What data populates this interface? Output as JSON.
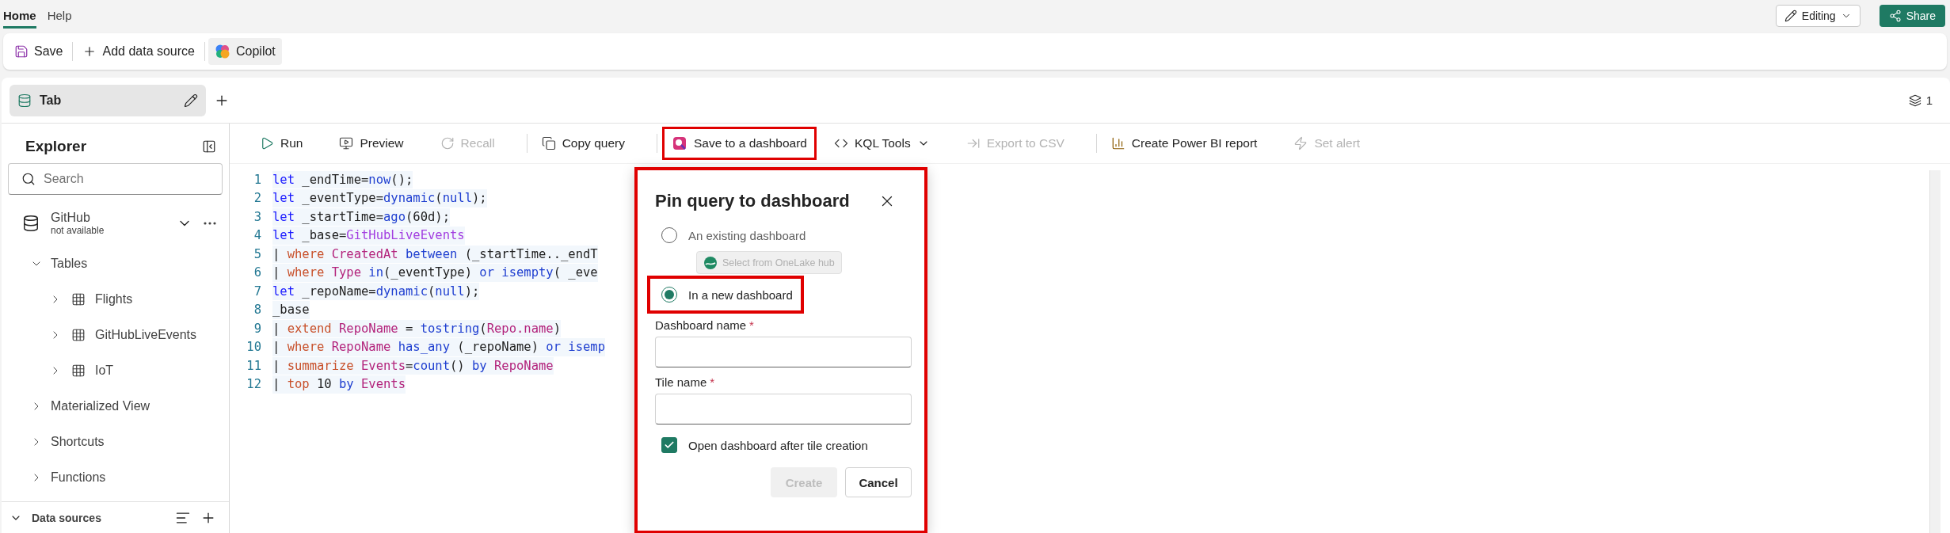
{
  "menu": {
    "tabs": [
      {
        "label": "Home",
        "selected": true
      },
      {
        "label": "Help",
        "selected": false
      }
    ],
    "mode": "Editing",
    "share": "Share"
  },
  "ribbon": [
    {
      "label": "Save",
      "kind": "save"
    },
    {
      "label": "Add data source",
      "kind": "add"
    },
    {
      "label": "Copilot",
      "kind": "copilot"
    }
  ],
  "query_tabs": [
    {
      "label": "Tab",
      "selected": true
    }
  ],
  "tab_count": "1",
  "explorer": {
    "title": "Explorer",
    "search": {
      "placeholder": "Search"
    },
    "database": {
      "name": "GitHub",
      "status": "not available"
    },
    "tree": [
      {
        "label": "Tables",
        "kind": "folder",
        "expanded": true,
        "children": [
          {
            "label": "Flights",
            "kind": "table",
            "expanded": false
          },
          {
            "label": "GitHubLiveEvents",
            "kind": "table",
            "expanded": false
          },
          {
            "label": "IoT",
            "kind": "table",
            "expanded": false
          }
        ]
      },
      {
        "label": "Materialized View",
        "kind": "folder",
        "expanded": false
      },
      {
        "label": "Shortcuts",
        "kind": "folder",
        "expanded": false
      },
      {
        "label": "Functions",
        "kind": "folder",
        "expanded": false
      }
    ],
    "footer": {
      "label": "Data sources",
      "expanded": true
    }
  },
  "toolbar": [
    {
      "label": "Run",
      "kind": "run",
      "disabled": false,
      "highlighted": false
    },
    {
      "label": "Preview",
      "kind": "preview",
      "disabled": false,
      "highlighted": false
    },
    {
      "label": "Recall",
      "kind": "recall",
      "disabled": true,
      "highlighted": false
    },
    {
      "label": "Copy query",
      "kind": "copy",
      "disabled": false,
      "highlighted": false
    },
    {
      "label": "Save to a dashboard",
      "kind": "dashboard",
      "disabled": false,
      "highlighted": true
    },
    {
      "label": "KQL Tools",
      "kind": "kql",
      "disabled": false,
      "highlighted": false
    },
    {
      "label": "Export to CSV",
      "kind": "export",
      "disabled": true,
      "highlighted": false
    },
    {
      "label": "Create Power BI report",
      "kind": "powerbi",
      "disabled": false,
      "highlighted": false
    },
    {
      "label": "Set alert",
      "kind": "alert",
      "disabled": true,
      "highlighted": false
    }
  ],
  "code": {
    "lines": [
      {
        "number": "1",
        "tokens": [
          {
            "kind": "keyword",
            "text": "let"
          },
          {
            "kind": "plain",
            "text": " _endTime="
          },
          {
            "kind": "function",
            "text": "now"
          },
          {
            "kind": "plain",
            "text": "();"
          }
        ]
      },
      {
        "number": "2",
        "tokens": [
          {
            "kind": "keyword",
            "text": "let"
          },
          {
            "kind": "plain",
            "text": " _eventType="
          },
          {
            "kind": "function",
            "text": "dynamic"
          },
          {
            "kind": "plain",
            "text": "("
          },
          {
            "kind": "function",
            "text": "null"
          },
          {
            "kind": "plain",
            "text": ");"
          }
        ]
      },
      {
        "number": "3",
        "tokens": [
          {
            "kind": "keyword",
            "text": "let"
          },
          {
            "kind": "plain",
            "text": " _startTime="
          },
          {
            "kind": "function",
            "text": "ago"
          },
          {
            "kind": "plain",
            "text": "(60d);"
          }
        ]
      },
      {
        "number": "4",
        "tokens": [
          {
            "kind": "keyword",
            "text": "let"
          },
          {
            "kind": "plain",
            "text": " _base="
          },
          {
            "kind": "table",
            "text": "GitHubLiveEvents"
          }
        ]
      },
      {
        "number": "5",
        "tokens": [
          {
            "kind": "plain",
            "text": "| "
          },
          {
            "kind": "operator",
            "text": "where"
          },
          {
            "kind": "column",
            "text": " CreatedAt"
          },
          {
            "kind": "function",
            "text": " between"
          },
          {
            "kind": "plain",
            "text": " (_startTime.._endT"
          }
        ]
      },
      {
        "number": "6",
        "tokens": [
          {
            "kind": "plain",
            "text": "| "
          },
          {
            "kind": "operator",
            "text": "where"
          },
          {
            "kind": "column",
            "text": " Type"
          },
          {
            "kind": "function",
            "text": " in"
          },
          {
            "kind": "plain",
            "text": "(_eventType) "
          },
          {
            "kind": "function",
            "text": "or"
          },
          {
            "kind": "function",
            "text": " isempty"
          },
          {
            "kind": "plain",
            "text": "( _eve"
          }
        ]
      },
      {
        "number": "7",
        "tokens": [
          {
            "kind": "keyword",
            "text": "let"
          },
          {
            "kind": "plain",
            "text": " _repoName="
          },
          {
            "kind": "function",
            "text": "dynamic"
          },
          {
            "kind": "plain",
            "text": "("
          },
          {
            "kind": "function",
            "text": "null"
          },
          {
            "kind": "plain",
            "text": ");"
          }
        ]
      },
      {
        "number": "8",
        "tokens": [
          {
            "kind": "plain",
            "text": "_base"
          }
        ]
      },
      {
        "number": "9",
        "tokens": [
          {
            "kind": "plain",
            "text": "| "
          },
          {
            "kind": "operator",
            "text": "extend"
          },
          {
            "kind": "column",
            "text": " RepoName"
          },
          {
            "kind": "plain",
            "text": " = "
          },
          {
            "kind": "function",
            "text": "tostring"
          },
          {
            "kind": "plain",
            "text": "("
          },
          {
            "kind": "column",
            "text": "Repo.name"
          },
          {
            "kind": "plain",
            "text": ")"
          }
        ]
      },
      {
        "number": "10",
        "tokens": [
          {
            "kind": "plain",
            "text": "| "
          },
          {
            "kind": "operator",
            "text": "where"
          },
          {
            "kind": "column",
            "text": " RepoName"
          },
          {
            "kind": "function",
            "text": " has_any"
          },
          {
            "kind": "plain",
            "text": " (_repoName) "
          },
          {
            "kind": "function",
            "text": "or"
          },
          {
            "kind": "function",
            "text": " isemp"
          }
        ]
      },
      {
        "number": "11",
        "tokens": [
          {
            "kind": "plain",
            "text": "| "
          },
          {
            "kind": "operator",
            "text": "summarize"
          },
          {
            "kind": "column",
            "text": " Events"
          },
          {
            "kind": "plain",
            "text": "="
          },
          {
            "kind": "function",
            "text": "count"
          },
          {
            "kind": "plain",
            "text": "() "
          },
          {
            "kind": "function",
            "text": "by"
          },
          {
            "kind": "column",
            "text": " RepoName"
          }
        ]
      },
      {
        "number": "12",
        "tokens": [
          {
            "kind": "plain",
            "text": "| "
          },
          {
            "kind": "operator",
            "text": "top"
          },
          {
            "kind": "plain",
            "text": " 10 "
          },
          {
            "kind": "function",
            "text": "by"
          },
          {
            "kind": "column",
            "text": " Events"
          }
        ]
      }
    ]
  },
  "dialog": {
    "title": "Pin query to dashboard",
    "highlighted": true,
    "options": [
      {
        "label": "An existing dashboard",
        "selected": false,
        "highlighted": false
      },
      {
        "label": "In a new dashboard",
        "selected": true,
        "highlighted": true
      }
    ],
    "hub_button": {
      "label": "Select from OneLake hub",
      "disabled": true
    },
    "fields": [
      {
        "label": "Dashboard name",
        "required_mark": "*"
      },
      {
        "label": "Tile name",
        "required_mark": "*"
      }
    ],
    "checkbox": {
      "label": "Open dashboard after tile creation",
      "checked": true
    },
    "buttons": [
      {
        "label": "Create",
        "kind": "primary",
        "disabled": true
      },
      {
        "label": "Cancel",
        "kind": "secondary",
        "disabled": false
      }
    ]
  }
}
